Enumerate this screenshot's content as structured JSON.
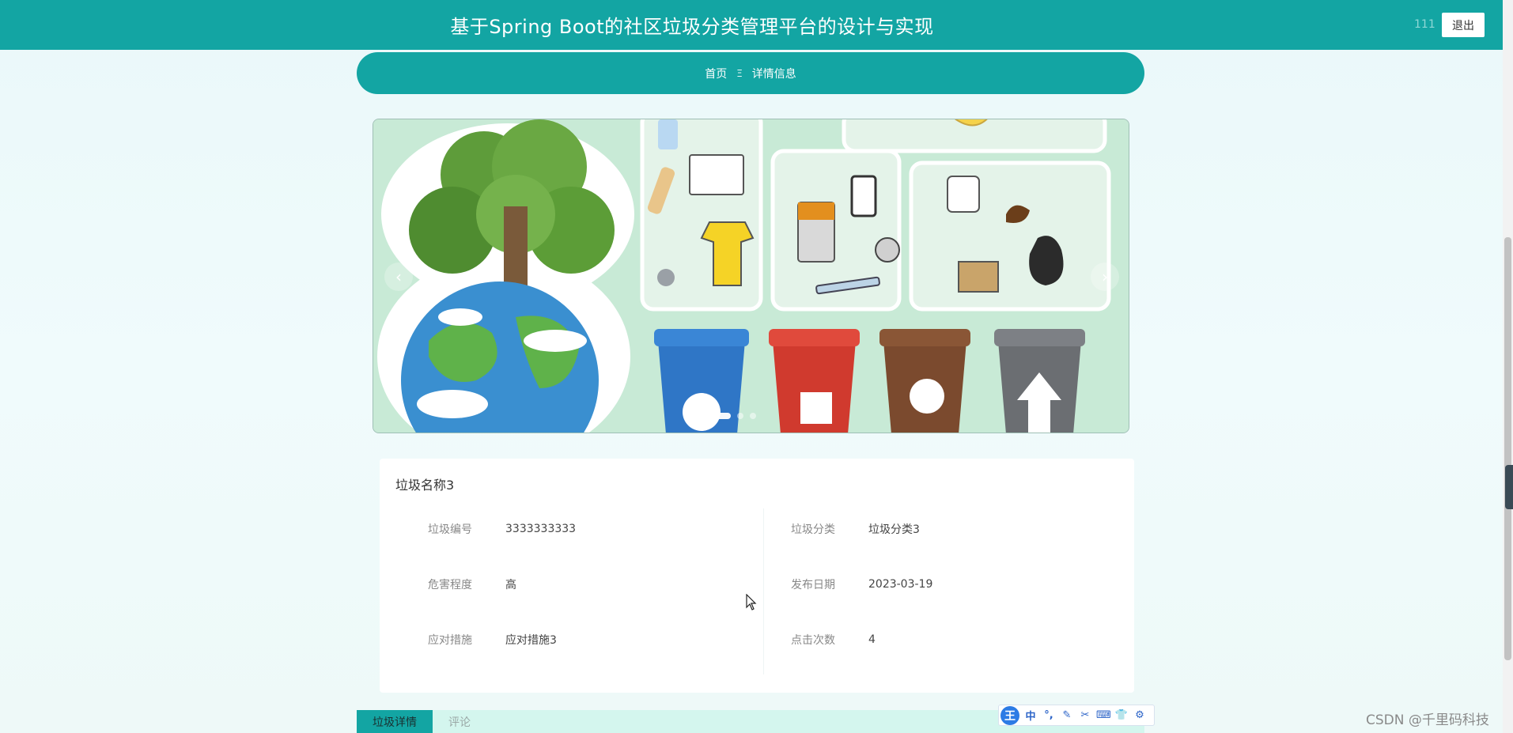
{
  "header": {
    "title": "基于Spring Boot的社区垃圾分类管理平台的设计与实现",
    "username": "111",
    "logout_label": "退出"
  },
  "breadcrumb": {
    "home": "首页",
    "separator": "Ξ",
    "current": "详情信息"
  },
  "carousel": {
    "prev_icon": "‹",
    "next_icon": "›",
    "slide_count": 3,
    "active_index": 0
  },
  "detail": {
    "name": "垃圾名称3",
    "fields": {
      "code_label": "垃圾编号",
      "code_value": "3333333333",
      "category_label": "垃圾分类",
      "category_value": "垃圾分类3",
      "hazard_label": "危害程度",
      "hazard_value": "高",
      "date_label": "发布日期",
      "date_value": "2023-03-19",
      "measure_label": "应对措施",
      "measure_value": "应对措施3",
      "clicks_label": "点击次数",
      "clicks_value": "4"
    }
  },
  "tabs": [
    {
      "label": "垃圾详情",
      "active": true
    },
    {
      "label": "评论",
      "active": false
    }
  ],
  "ime_toolbar": {
    "logo": "王",
    "items": [
      "中",
      "°,",
      "✎",
      "✂",
      "⌨",
      "👕",
      "⚙"
    ]
  },
  "watermark": "CSDN @千里码科技",
  "colors": {
    "primary": "#13a5a3",
    "background": "#eaf8f9",
    "tab_bg": "#d4f6ee"
  }
}
